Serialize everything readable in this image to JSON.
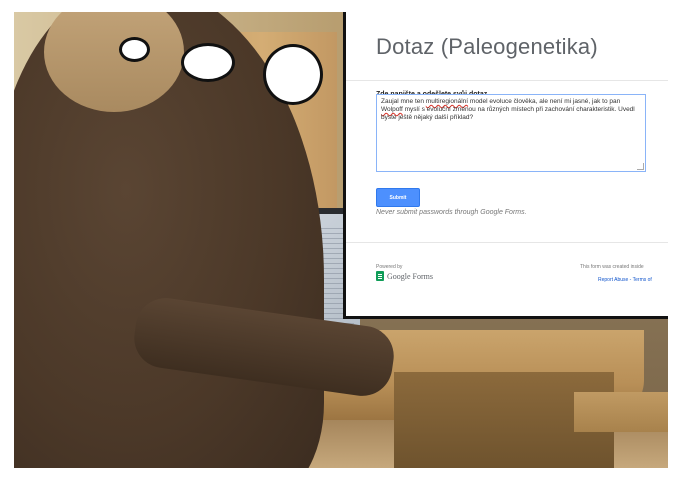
{
  "form": {
    "title": "Dotaz (Paleogenetika)",
    "question_label": "Zde napište a odešlete svůj dotaz",
    "answer_parts": {
      "p1": "Zaujal mne ten ",
      "w1": "multiregionální",
      "p2": " model evoluce člověka, ale není mi jasné, jak to pan ",
      "w2": "Wolpoff",
      "p3": " myslí s evoluční změnou na různých místech při zachování charakteristik. Uvedl byste ještě nějaký další příklad?"
    },
    "submit_label": "Submit",
    "warning": "Never submit passwords through Google Forms.",
    "powered_by": "Powered by",
    "logo_text": "Google Forms",
    "created_note": "This form was created inside",
    "report_links": "Report Abuse - Terms of"
  },
  "colors": {
    "submit_bg": "#4d90fe",
    "link": "#1155cc",
    "forms_green": "#0f9d58"
  }
}
